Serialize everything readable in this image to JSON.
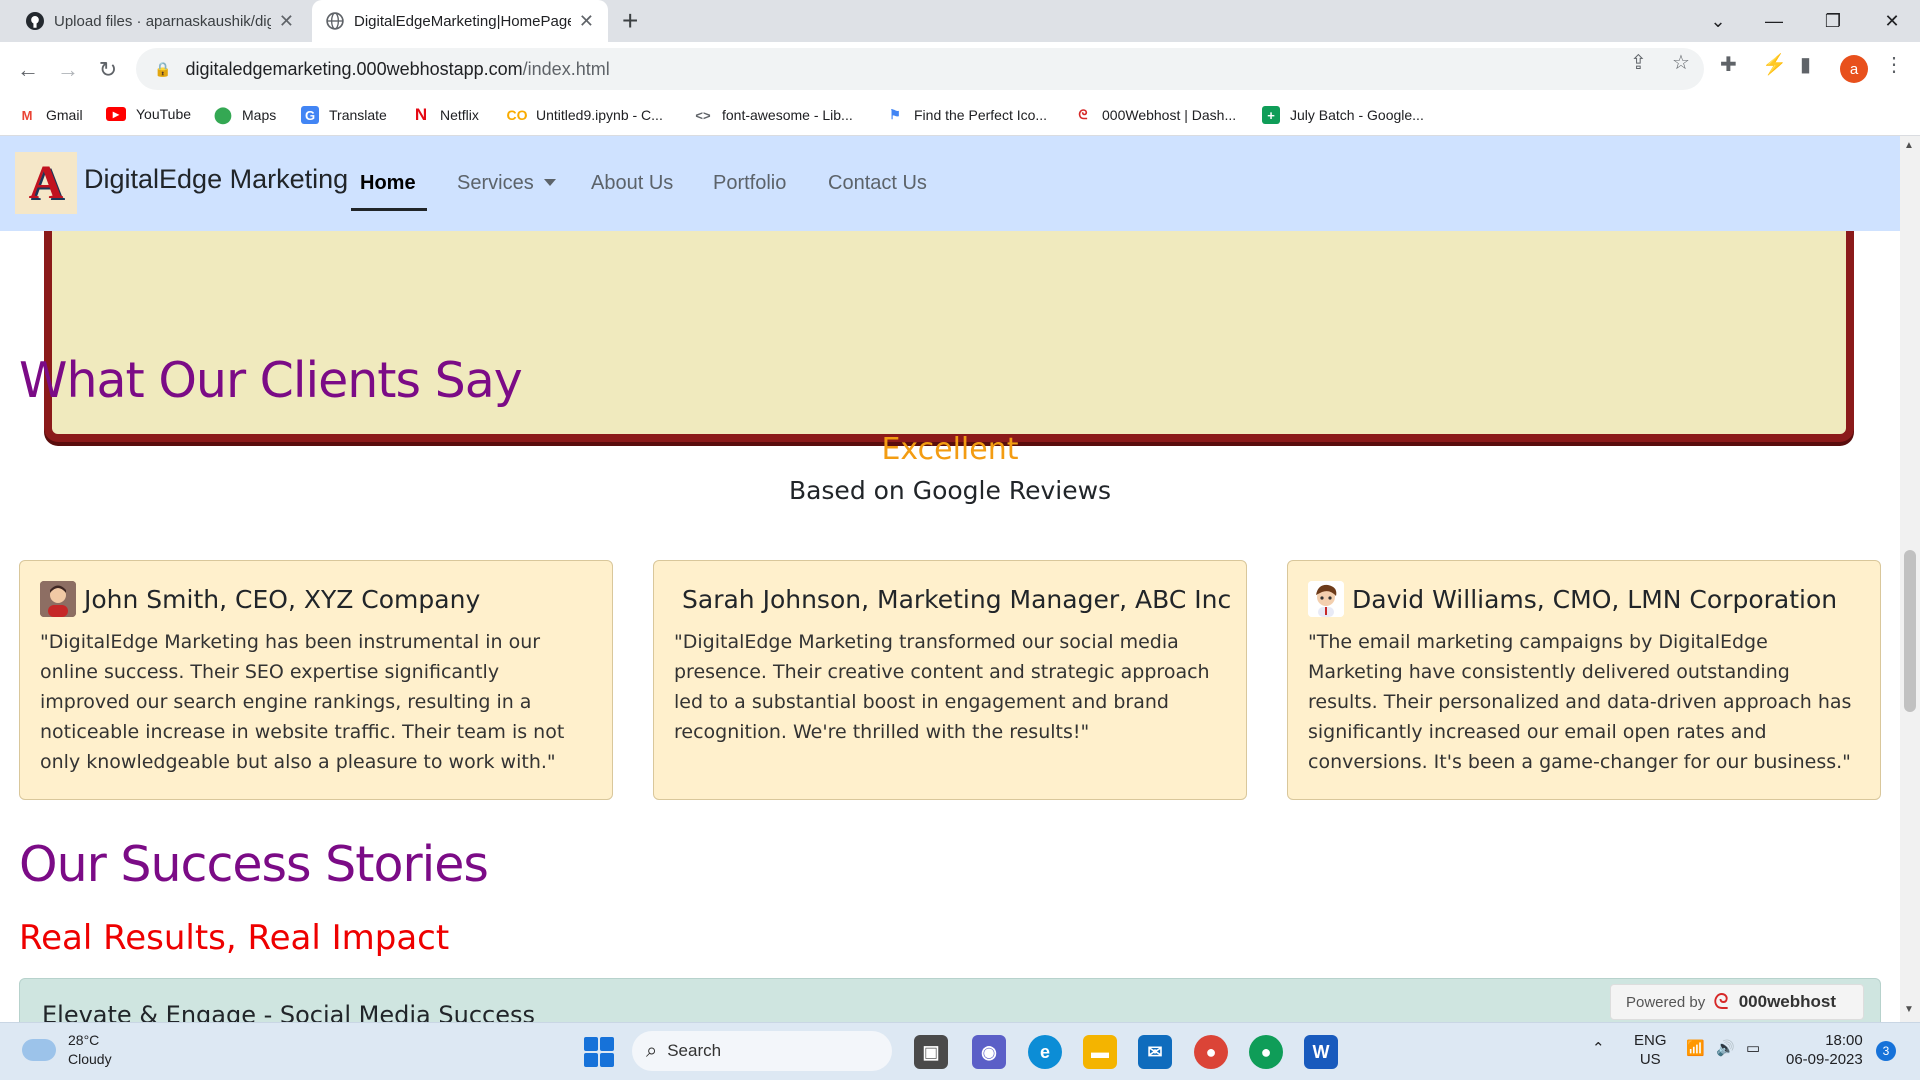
{
  "browser": {
    "tabs": [
      {
        "title": "Upload files · aparnaskaushik/dig",
        "icon": "github-icon"
      },
      {
        "title": "DigitalEdgeMarketing|HomePage",
        "icon": "globe-icon"
      }
    ],
    "url_domain": "digitaledgemarketing.000webhostapp.com",
    "url_path": "/index.html",
    "profile_initial": "a",
    "bookmarks": [
      {
        "label": "Gmail",
        "icon": "gmail-icon"
      },
      {
        "label": "YouTube",
        "icon": "youtube-icon"
      },
      {
        "label": "Maps",
        "icon": "maps-icon"
      },
      {
        "label": "Translate",
        "icon": "translate-icon"
      },
      {
        "label": "Netflix",
        "icon": "netflix-icon"
      },
      {
        "label": "Untitled9.ipynb - C...",
        "icon": "colab-icon"
      },
      {
        "label": "font-awesome - Lib...",
        "icon": "code-icon"
      },
      {
        "label": "Find the Perfect Ico...",
        "icon": "flag-icon"
      },
      {
        "label": "000Webhost | Dash...",
        "icon": "webhost-icon"
      },
      {
        "label": "July Batch - Google...",
        "icon": "sheets-icon"
      }
    ]
  },
  "site": {
    "brand": "DigitalEdge Marketing",
    "logo_letter": "A",
    "nav": {
      "home": "Home",
      "services": "Services",
      "about": "About Us",
      "portfolio": "Portfolio",
      "contact": "Contact Us"
    },
    "testimonials": {
      "heading": "What Our Clients Say",
      "rating": "Excellent",
      "rating_source": "Based on Google Reviews",
      "cards": [
        {
          "name": "John Smith, CEO, XYZ Company",
          "quote": "\"DigitalEdge Marketing has been instrumental in our online success. Their SEO expertise significantly improved our search engine rankings, resulting in a noticeable increase in website traffic. Their team is not only knowledgeable but also a pleasure to work with.\""
        },
        {
          "name": "Sarah Johnson, Marketing Manager, ABC Inc",
          "quote": "\"DigitalEdge Marketing transformed our social media presence. Their creative content and strategic approach led to a substantial boost in engagement and brand recognition. We're thrilled with the results!\""
        },
        {
          "name": "David Williams, CMO, LMN Corporation",
          "quote": "\"The email marketing campaigns by DigitalEdge Marketing have consistently delivered outstanding results. Their personalized and data-driven approach has significantly increased our email open rates and conversions. It's been a game-changer for our business.\""
        }
      ]
    },
    "success": {
      "heading": "Our Success Stories",
      "subheading": "Real Results, Real Impact",
      "first_story": "Elevate & Engage - Social Media Success"
    },
    "powered_by": {
      "label": "Powered by",
      "brand": "000webhost"
    }
  },
  "taskbar": {
    "weather_temp": "28°C",
    "weather_desc": "Cloudy",
    "search_label": "Search",
    "lang_line1": "ENG",
    "lang_line2": "US",
    "time": "18:00",
    "date": "06-09-2023",
    "notification_count": "3"
  }
}
